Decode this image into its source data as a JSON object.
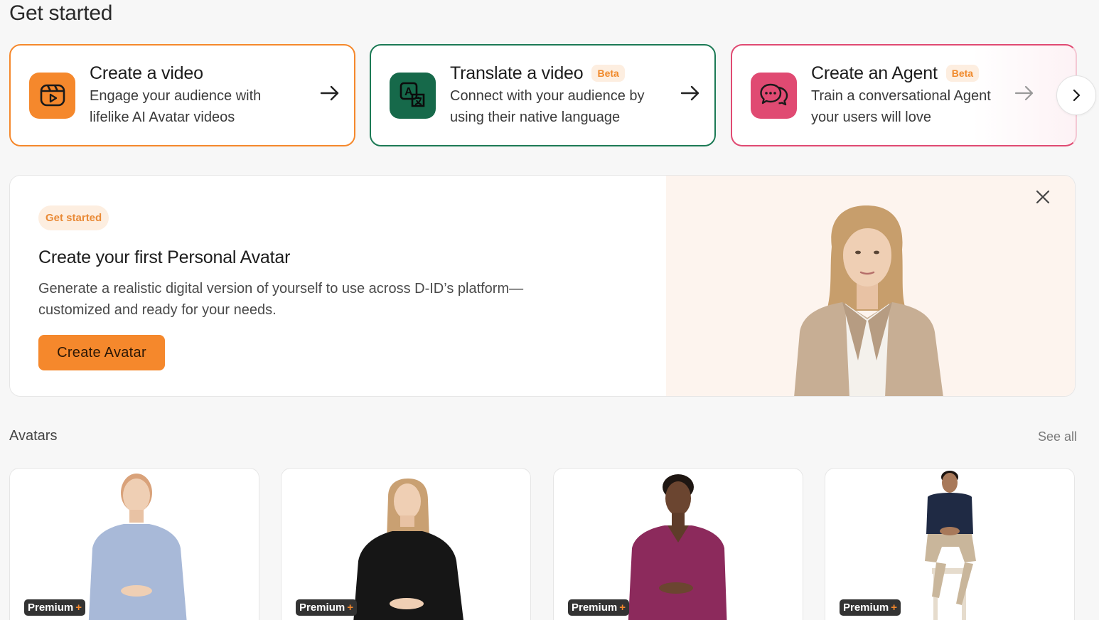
{
  "page": {
    "title": "Get started"
  },
  "actions": [
    {
      "title": "Create a video",
      "desc_line1": "Engage your audience with",
      "desc_line2": "lifelike AI Avatar videos",
      "badge": "",
      "icon": "video-play-icon",
      "color": "#f5882c"
    },
    {
      "title": "Translate a video",
      "desc_line1": "Connect with your audience by",
      "desc_line2": "using their native language",
      "badge": "Beta",
      "icon": "translate-icon",
      "color": "#16694a"
    },
    {
      "title": "Create an Agent",
      "desc_line1": "Train a conversational Agent",
      "desc_line2": "your users will love",
      "badge": "Beta",
      "icon": "chat-bubbles-icon",
      "color": "#e04a72"
    }
  ],
  "banner": {
    "chip": "Get started",
    "title": "Create your first Personal Avatar",
    "desc_line1": "Generate a realistic digital version of yourself to use across D-ID’s platform—",
    "desc_line2": "customized and ready for your needs.",
    "button": "Create Avatar"
  },
  "avatars": {
    "title": "Avatars",
    "see_all": "See all",
    "items": [
      {
        "badge": "Premium",
        "plus": "+",
        "outfit": "#a8b9d8"
      },
      {
        "badge": "Premium",
        "plus": "+",
        "outfit": "#1a1a1a"
      },
      {
        "badge": "Premium",
        "plus": "+",
        "outfit": "#8c2a5c"
      },
      {
        "badge": "Premium",
        "plus": "+",
        "outfit": "#1f2a44"
      }
    ]
  },
  "colors": {
    "accent": "#f5882c",
    "green": "#16694a",
    "pink": "#e04a72"
  }
}
